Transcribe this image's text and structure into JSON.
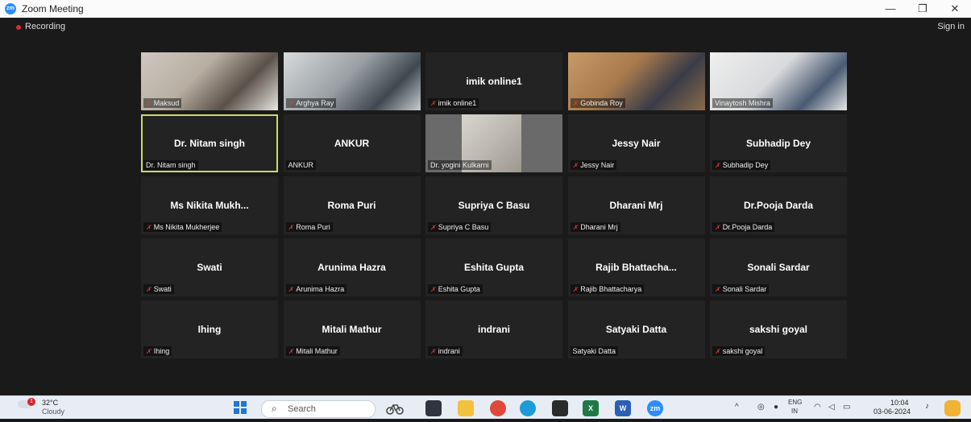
{
  "window": {
    "app_icon_text": "zm",
    "title": "Zoom Meeting",
    "minimize_glyph": "—",
    "restore_glyph": "❐",
    "close_glyph": "✕"
  },
  "meeting": {
    "recording_label": "Recording",
    "sign_in_label": "Sign in"
  },
  "participants": [
    {
      "tile": "",
      "label": "Maksud",
      "muted": true,
      "video": true
    },
    {
      "tile": "",
      "label": "Arghya Ray",
      "muted": true,
      "video": true
    },
    {
      "tile": "imik online1",
      "label": "imik online1",
      "muted": true,
      "video": false
    },
    {
      "tile": "",
      "label": "Gobinda Roy",
      "muted": true,
      "video": true
    },
    {
      "tile": "",
      "label": "Vinaytosh Mishra",
      "muted": false,
      "video": true
    },
    {
      "tile": "Dr. Nitam singh",
      "label": "Dr. Nitam singh",
      "muted": false,
      "video": false,
      "speaking": true
    },
    {
      "tile": "ANKUR",
      "label": "ANKUR",
      "muted": false,
      "video": false
    },
    {
      "tile": "",
      "label": "Dr. yogini Kulkarni",
      "muted": false,
      "video": true
    },
    {
      "tile": "Jessy Nair",
      "label": "Jessy Nair",
      "muted": true,
      "video": false
    },
    {
      "tile": "Subhadip Dey",
      "label": "Subhadip Dey",
      "muted": true,
      "video": false
    },
    {
      "tile": "Ms Nikita Mukh...",
      "label": "Ms Nikita Mukherjee",
      "muted": true,
      "video": false
    },
    {
      "tile": "Roma Puri",
      "label": "Roma Puri",
      "muted": true,
      "video": false
    },
    {
      "tile": "Supriya C Basu",
      "label": "Supriya C Basu",
      "muted": true,
      "video": false
    },
    {
      "tile": "Dharani Mrj",
      "label": "Dharani Mrj",
      "muted": true,
      "video": false
    },
    {
      "tile": "Dr.Pooja Darda",
      "label": "Dr.Pooja Darda",
      "muted": true,
      "video": false
    },
    {
      "tile": "Swati",
      "label": "Swati",
      "muted": true,
      "video": false
    },
    {
      "tile": "Arunima Hazra",
      "label": "Arunima Hazra",
      "muted": true,
      "video": false
    },
    {
      "tile": "Eshita Gupta",
      "label": "Eshita Gupta",
      "muted": true,
      "video": false
    },
    {
      "tile": "Rajib Bhattacha...",
      "label": "Rajib Bhattacharya",
      "muted": true,
      "video": false
    },
    {
      "tile": "Sonali Sardar",
      "label": "Sonali Sardar",
      "muted": true,
      "video": false
    },
    {
      "tile": "Ihing",
      "label": "Ihing",
      "muted": true,
      "video": false
    },
    {
      "tile": "Mitali Mathur",
      "label": "Mitali Mathur",
      "muted": true,
      "video": false
    },
    {
      "tile": "indrani",
      "label": "indrani",
      "muted": true,
      "video": false
    },
    {
      "tile": "Satyaki Datta",
      "label": "Satyaki Datta",
      "muted": false,
      "video": false
    },
    {
      "tile": "sakshi goyal",
      "label": "sakshi goyal",
      "muted": true,
      "video": false
    }
  ],
  "taskbar": {
    "weather_badge": "1",
    "weather_temp": "32°C",
    "weather_desc": "Cloudy",
    "search_glyph": "⌕",
    "search_placeholder": "Search",
    "zoom_app_text": "zm",
    "excel_app_text": "X",
    "word_app_text": "W",
    "lang_line1": "ENG",
    "lang_line2": "IN",
    "time": "10:04",
    "date": "03-06-2024",
    "tray_chevron": "^"
  },
  "colors": {
    "accent": "#2d8cff",
    "speaking_border": "#cfd96a",
    "muted_icon": "#e03b3b",
    "recording": "#e02b2b"
  }
}
